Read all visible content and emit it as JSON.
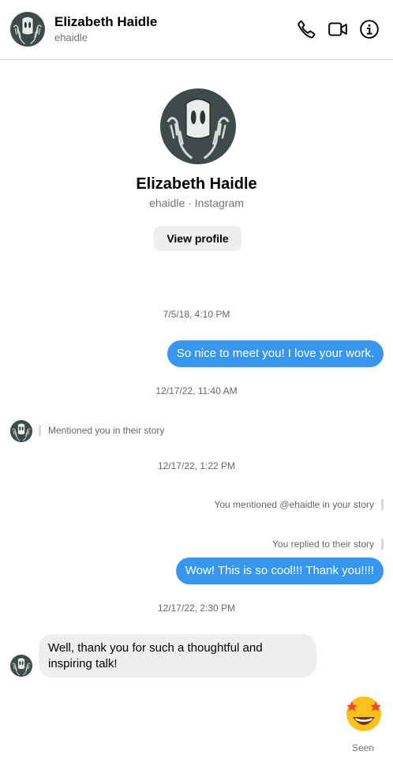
{
  "header": {
    "name": "Elizabeth Haidle",
    "handle": "ehaidle",
    "icons": [
      "phone-icon",
      "video-call-icon",
      "info-icon"
    ]
  },
  "profile": {
    "name": "Elizabeth Haidle",
    "subtitle": "ehaidle · Instagram",
    "view_profile_label": "View profile"
  },
  "thread": {
    "ts1": "7/5/18, 4:10 PM",
    "msg1": "So nice to meet you! I love your work.",
    "ts2": "12/17/22, 11:40 AM",
    "story_mention_in": "Mentioned you in their story",
    "ts3": "12/17/22, 1:22 PM",
    "story_mention_out": "You mentioned @ehaidle in your story",
    "story_reply_out": "You replied to their story",
    "msg2": "Wow! This is so cool!!! Thank you!!!!",
    "ts4": "12/17/22, 2:30 PM",
    "msg3": "Well, thank you for such a thoughtful and inspiring talk!",
    "reaction": "star-struck-emoji",
    "seen": "Seen"
  },
  "colors": {
    "accent": "#3797f0",
    "incoming_bubble": "#efefef",
    "avatar_bg": "#3f4a4b"
  }
}
